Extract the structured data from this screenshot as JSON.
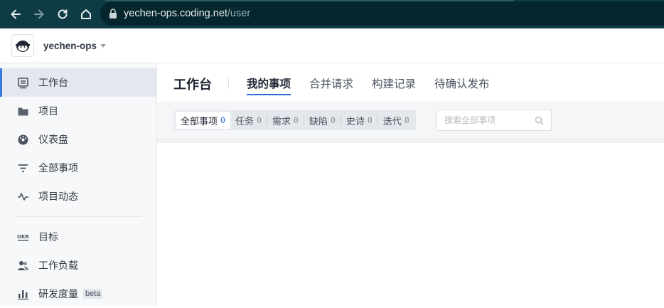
{
  "browser": {
    "url_host": "yechen-ops.coding.net",
    "url_path": "/user",
    "icons": [
      "back-icon",
      "forward-icon",
      "reload-icon",
      "home-icon",
      "lock-icon"
    ]
  },
  "header": {
    "team_name": "yechen-ops"
  },
  "sidebar": {
    "items": [
      {
        "label": "工作台",
        "icon": "workbench-icon",
        "active": true
      },
      {
        "label": "项目",
        "icon": "folder-icon"
      },
      {
        "label": "仪表盘",
        "icon": "dashboard-icon"
      },
      {
        "label": "全部事项",
        "icon": "filter-icon"
      },
      {
        "label": "项目动态",
        "icon": "activity-icon"
      },
      {
        "label": "目标",
        "icon": "okr-icon"
      },
      {
        "label": "工作负载",
        "icon": "users-icon"
      },
      {
        "label": "研发度量",
        "icon": "bar-chart-icon",
        "badge": "beta"
      }
    ]
  },
  "main": {
    "title": "工作台",
    "tabs": [
      {
        "label": "我的事项",
        "active": true
      },
      {
        "label": "合并请求"
      },
      {
        "label": "构建记录"
      },
      {
        "label": "待确认发布"
      }
    ],
    "filters": [
      {
        "label": "全部事项",
        "count": "0",
        "active": true
      },
      {
        "label": "任务",
        "count": "0"
      },
      {
        "label": "需求",
        "count": "0"
      },
      {
        "label": "缺陷",
        "count": "0"
      },
      {
        "label": "史诗",
        "count": "0"
      },
      {
        "label": "迭代",
        "count": "0"
      }
    ],
    "search_placeholder": "搜索全部事项"
  },
  "colors": {
    "browser_bar": "#0e3b44",
    "accent": "#2c6ed5"
  }
}
